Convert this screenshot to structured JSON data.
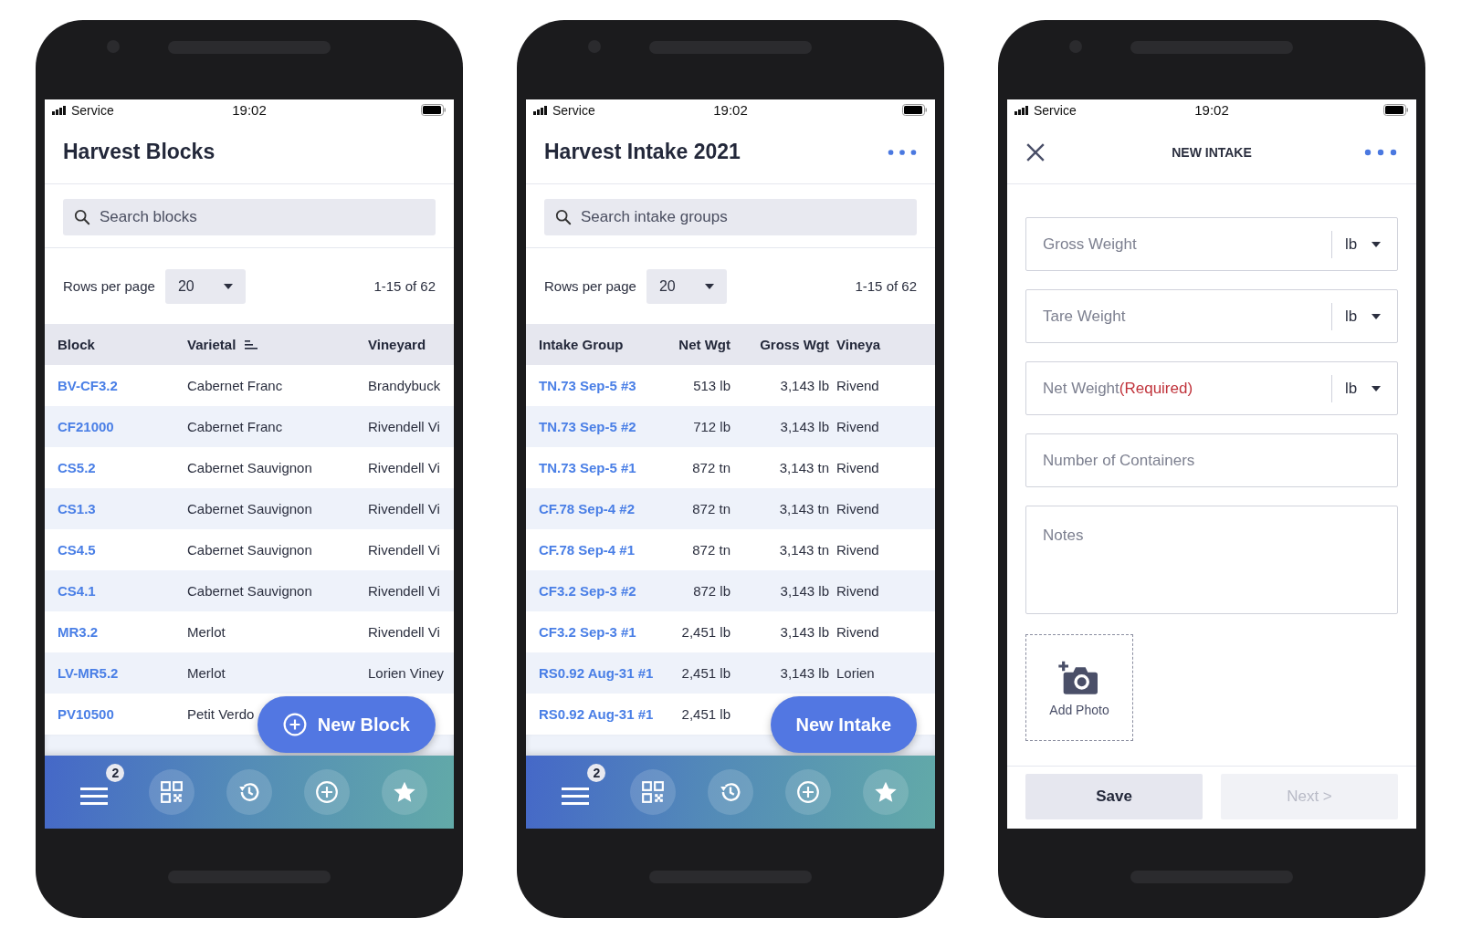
{
  "phones": [
    {
      "kind": "list",
      "status": {
        "carrier": "Service",
        "time": "19:02"
      },
      "title": "Harvest Blocks",
      "menu_button": false,
      "search": {
        "placeholder": "Search blocks"
      },
      "pager": {
        "label": "Rows per page",
        "value": "20",
        "range": "1-15 of 62"
      },
      "table": {
        "columns": [
          {
            "label": "Block",
            "kind": "id",
            "sorted": false
          },
          {
            "label": "Varietal",
            "kind": "name",
            "sorted": true
          },
          {
            "label": "Vineyard",
            "kind": "place",
            "sorted": false
          }
        ],
        "rows": [
          [
            "BV-CF3.2",
            "Cabernet Franc",
            "Brandybuck"
          ],
          [
            "CF21000",
            "Cabernet Franc",
            "Rivendell Vi"
          ],
          [
            "CS5.2",
            "Cabernet Sauvignon",
            "Rivendell Vi"
          ],
          [
            "CS1.3",
            "Cabernet Sauvignon",
            "Rivendell Vi"
          ],
          [
            "CS4.5",
            "Cabernet Sauvignon",
            "Rivendell Vi"
          ],
          [
            "CS4.1",
            "Cabernet Sauvignon",
            "Rivendell Vi"
          ],
          [
            "MR3.2",
            "Merlot",
            "Rivendell Vi"
          ],
          [
            "LV-MR5.2",
            "Merlot",
            "Lorien Viney"
          ],
          [
            "PV10500",
            "Petit Verdo",
            null
          ]
        ]
      },
      "fab": {
        "label": "New Block",
        "plus_icon": true
      },
      "nav": [
        {
          "kind": "menu",
          "badge": "2"
        },
        {
          "kind": "qr"
        },
        {
          "kind": "history"
        },
        {
          "kind": "add"
        },
        {
          "kind": "star"
        }
      ]
    },
    {
      "kind": "list",
      "status": {
        "carrier": "Service",
        "time": "19:02"
      },
      "title": "Harvest Intake 2021",
      "menu_button": true,
      "search": {
        "placeholder": "Search intake groups"
      },
      "pager": {
        "label": "Rows per page",
        "value": "20",
        "range": "1-15 of 62"
      },
      "table": {
        "columns": [
          {
            "label": "Intake Group",
            "kind": "group",
            "sorted": false
          },
          {
            "label": "Net Wgt",
            "kind": "weight",
            "sorted": false
          },
          {
            "label": "Gross Wgt",
            "kind": "gross",
            "sorted": false
          },
          {
            "label": "Vineya",
            "kind": "short",
            "sorted": false
          }
        ],
        "rows": [
          [
            "TN.73 Sep-5 #3",
            "513 lb",
            "3,143 lb",
            "Rivend"
          ],
          [
            "TN.73 Sep-5 #2",
            "712 lb",
            "3,143 lb",
            "Rivend"
          ],
          [
            "TN.73 Sep-5 #1",
            "872 tn",
            "3,143 tn",
            "Rivend"
          ],
          [
            "CF.78 Sep-4 #2",
            "872 tn",
            "3,143 tn",
            "Rivend"
          ],
          [
            "CF.78 Sep-4 #1",
            "872 tn",
            "3,143 tn",
            "Rivend"
          ],
          [
            "CF3.2 Sep-3 #2",
            "872 lb",
            "3,143 lb",
            "Rivend"
          ],
          [
            "CF3.2 Sep-3 #1",
            "2,451 lb",
            "3,143 lb",
            "Rivend"
          ],
          [
            "RS0.92 Aug-31 #1",
            "2,451 lb",
            "3,143 lb",
            "Lorien"
          ],
          [
            "RS0.92 Aug-31 #1",
            "2,451 lb",
            null,
            null
          ]
        ]
      },
      "fab": {
        "label": "New Intake",
        "plus_icon": false
      },
      "nav": [
        {
          "kind": "menu",
          "badge": "2"
        },
        {
          "kind": "qr"
        },
        {
          "kind": "history"
        },
        {
          "kind": "add"
        },
        {
          "kind": "star"
        }
      ]
    },
    {
      "kind": "form",
      "status": {
        "carrier": "Service",
        "time": "19:02"
      },
      "title": "NEW INTAKE",
      "menu_button": true,
      "fields": [
        {
          "kind": "unit",
          "placeholder": "Gross Weight",
          "unit": "lb"
        },
        {
          "kind": "unit",
          "placeholder": "Tare Weight",
          "unit": "lb"
        },
        {
          "kind": "unit",
          "placeholder": "Net Weight",
          "required_note": "(Required)",
          "unit": "lb"
        },
        {
          "kind": "text",
          "placeholder": "Number of Containers"
        },
        {
          "kind": "area",
          "placeholder": "Notes"
        }
      ],
      "photo": {
        "label": "Add Photo"
      },
      "buttons": [
        {
          "label": "Save",
          "disabled": false
        },
        {
          "label": "Next >",
          "disabled": true
        }
      ]
    }
  ]
}
